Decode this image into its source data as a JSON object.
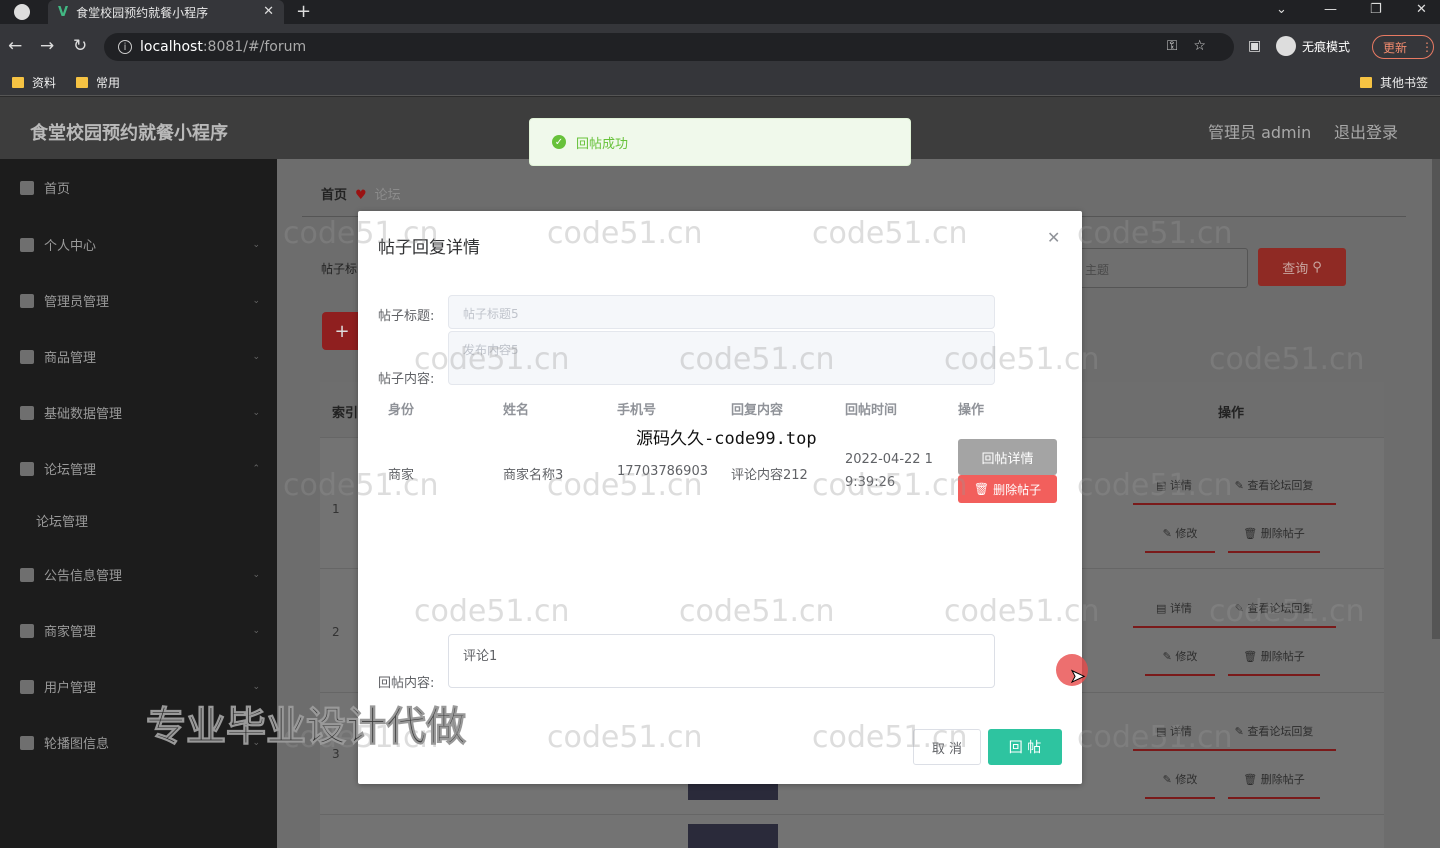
{
  "browser": {
    "tab_title": "食堂校园预约就餐小程序",
    "tab_logo": "V",
    "url_host": "localhost",
    "url_path": ":8081/#/forum",
    "incognito_label": "无痕模式",
    "update_label": "更新",
    "bookmarks": [
      "资料",
      "常用"
    ],
    "other_bookmarks": "其他书签"
  },
  "app": {
    "title": "食堂校园预约就餐小程序",
    "admin_label": "管理员 admin",
    "logout_label": "退出登录"
  },
  "sidebar": {
    "items": [
      {
        "label": "首页",
        "icon": "home-icon"
      },
      {
        "label": "个人中心",
        "icon": "user-icon"
      },
      {
        "label": "管理员管理",
        "icon": "menu-icon"
      },
      {
        "label": "商品管理",
        "icon": "goods-icon"
      },
      {
        "label": "基础数据管理",
        "icon": "data-icon"
      },
      {
        "label": "论坛管理",
        "icon": "forum-icon"
      },
      {
        "label": "公告信息管理",
        "icon": "notice-icon"
      },
      {
        "label": "商家管理",
        "icon": "merchant-icon"
      },
      {
        "label": "用户管理",
        "icon": "users-icon"
      },
      {
        "label": "轮播图信息",
        "icon": "carousel-icon"
      }
    ],
    "sub_item": "论坛管理"
  },
  "page": {
    "breadcrumb_home": "首页",
    "breadcrumb_current": "论坛",
    "filter_label_partial": "帖子标",
    "query_button": "查询",
    "query_placeholder": "主题",
    "add_button": "+",
    "table_header_index": "索引",
    "table_header_ops": "操作",
    "rows": [
      {
        "index": "1"
      },
      {
        "index": "2"
      },
      {
        "index": "3"
      }
    ],
    "ops": {
      "detail": "详情",
      "view_reply": "查看论坛回复",
      "edit": "修改",
      "delete": "删除帖子"
    }
  },
  "toast": {
    "message": "回帖成功"
  },
  "dialog": {
    "title": "帖子回复详情",
    "title_label": "帖子标题:",
    "title_value": "帖子标题5",
    "content_label": "帖子内容:",
    "content_value": "发布内容5",
    "columns": [
      "身份",
      "姓名",
      "手机号",
      "回复内容",
      "回帖时间",
      "操作"
    ],
    "reply_row": {
      "identity": "商家",
      "name": "商家名称3",
      "phone": "17703786903",
      "content": "评论内容212",
      "time_line1": "2022-04-22 1",
      "time_line2": "9:39:26"
    },
    "detail_button": "回帖详情",
    "delete_button": "删除帖子",
    "reply_label": "回帖内容:",
    "reply_value": "评论1",
    "cancel_button": "取 消",
    "submit_button": "回 帖"
  },
  "overlays": {
    "source_watermark": "源码久久-code99.top",
    "site_watermark": "code51.cn",
    "promo_watermark": "专业毕业设计代做"
  }
}
